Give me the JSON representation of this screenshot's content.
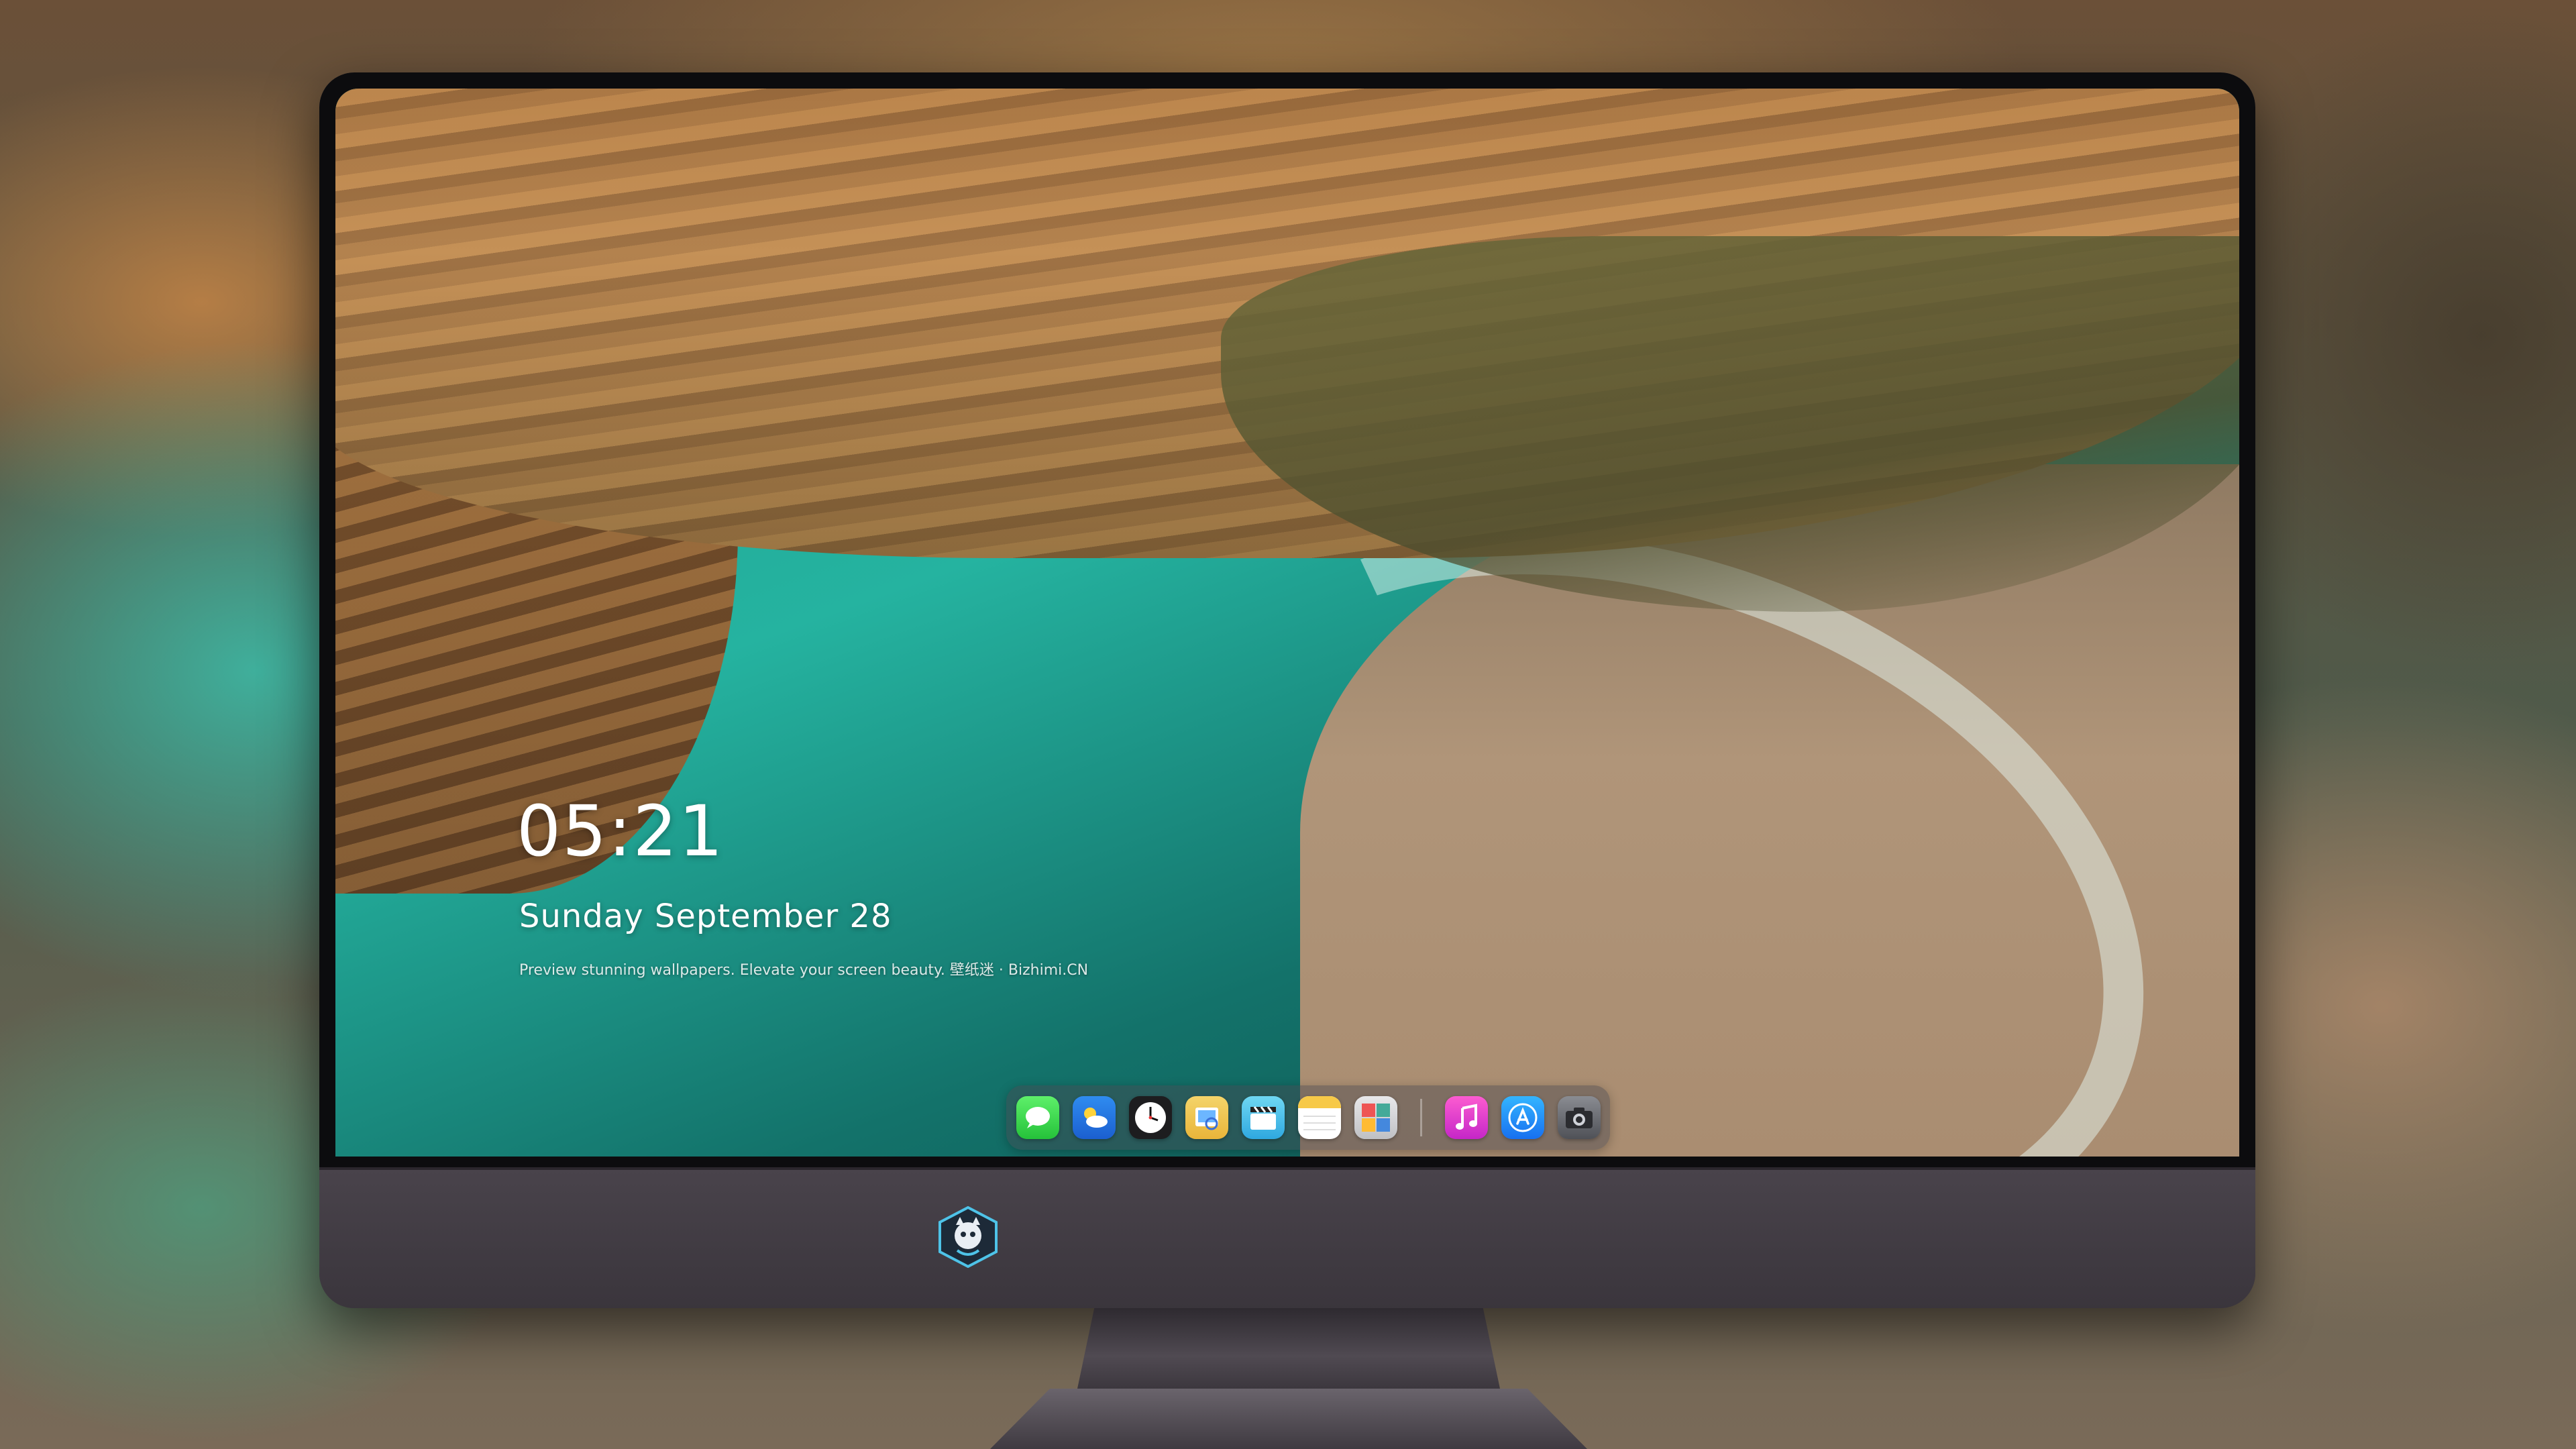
{
  "lockscreen": {
    "time": "05:21",
    "date": "Sunday September  28",
    "tagline": "Preview stunning wallpapers. Elevate your screen beauty. 壁纸迷 · Bizhimi.CN"
  },
  "dock": {
    "apps": [
      {
        "name": "Messages",
        "icon": "messages-icon"
      },
      {
        "name": "Weather",
        "icon": "weather-icon"
      },
      {
        "name": "Clock",
        "icon": "clock-icon"
      },
      {
        "name": "Preview",
        "icon": "preview-icon"
      },
      {
        "name": "Clips",
        "icon": "clips-icon"
      },
      {
        "name": "Notes",
        "icon": "notes-icon"
      },
      {
        "name": "Photo Booth",
        "icon": "photo-booth-icon"
      },
      {
        "name": "Music",
        "icon": "music-icon"
      },
      {
        "name": "App Store",
        "icon": "app-store-icon"
      },
      {
        "name": "Camera",
        "icon": "camera-icon"
      }
    ]
  },
  "colors": {
    "monitor_frame": "#3e3840",
    "bezel": "#0c0c0e",
    "text": "#ffffff"
  }
}
